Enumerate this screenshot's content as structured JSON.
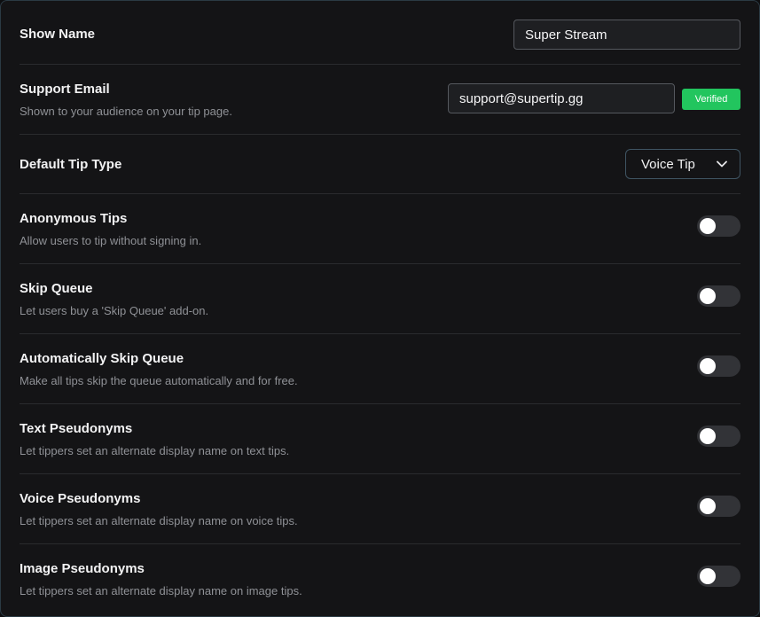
{
  "show_name": {
    "label": "Show Name",
    "value": "Super Stream"
  },
  "support_email": {
    "label": "Support Email",
    "description": "Shown to your audience on your tip page.",
    "value": "support@supertip.gg",
    "badge": "Verified",
    "badge_color": "#22c55e"
  },
  "default_tip_type": {
    "label": "Default Tip Type",
    "selected": "Voice Tip"
  },
  "toggles": [
    {
      "label": "Anonymous Tips",
      "description": "Allow users to tip without signing in.",
      "enabled": false
    },
    {
      "label": "Skip Queue",
      "description": "Let users buy a 'Skip Queue' add-on.",
      "enabled": false
    },
    {
      "label": "Automatically Skip Queue",
      "description": "Make all tips skip the queue automatically and for free.",
      "enabled": false
    },
    {
      "label": "Text Pseudonyms",
      "description": "Let tippers set an alternate display name on text tips.",
      "enabled": false
    },
    {
      "label": "Voice Pseudonyms",
      "description": "Let tippers set an alternate display name on voice tips.",
      "enabled": false
    },
    {
      "label": "Image Pseudonyms",
      "description": "Let tippers set an alternate display name on image tips.",
      "enabled": false
    }
  ]
}
